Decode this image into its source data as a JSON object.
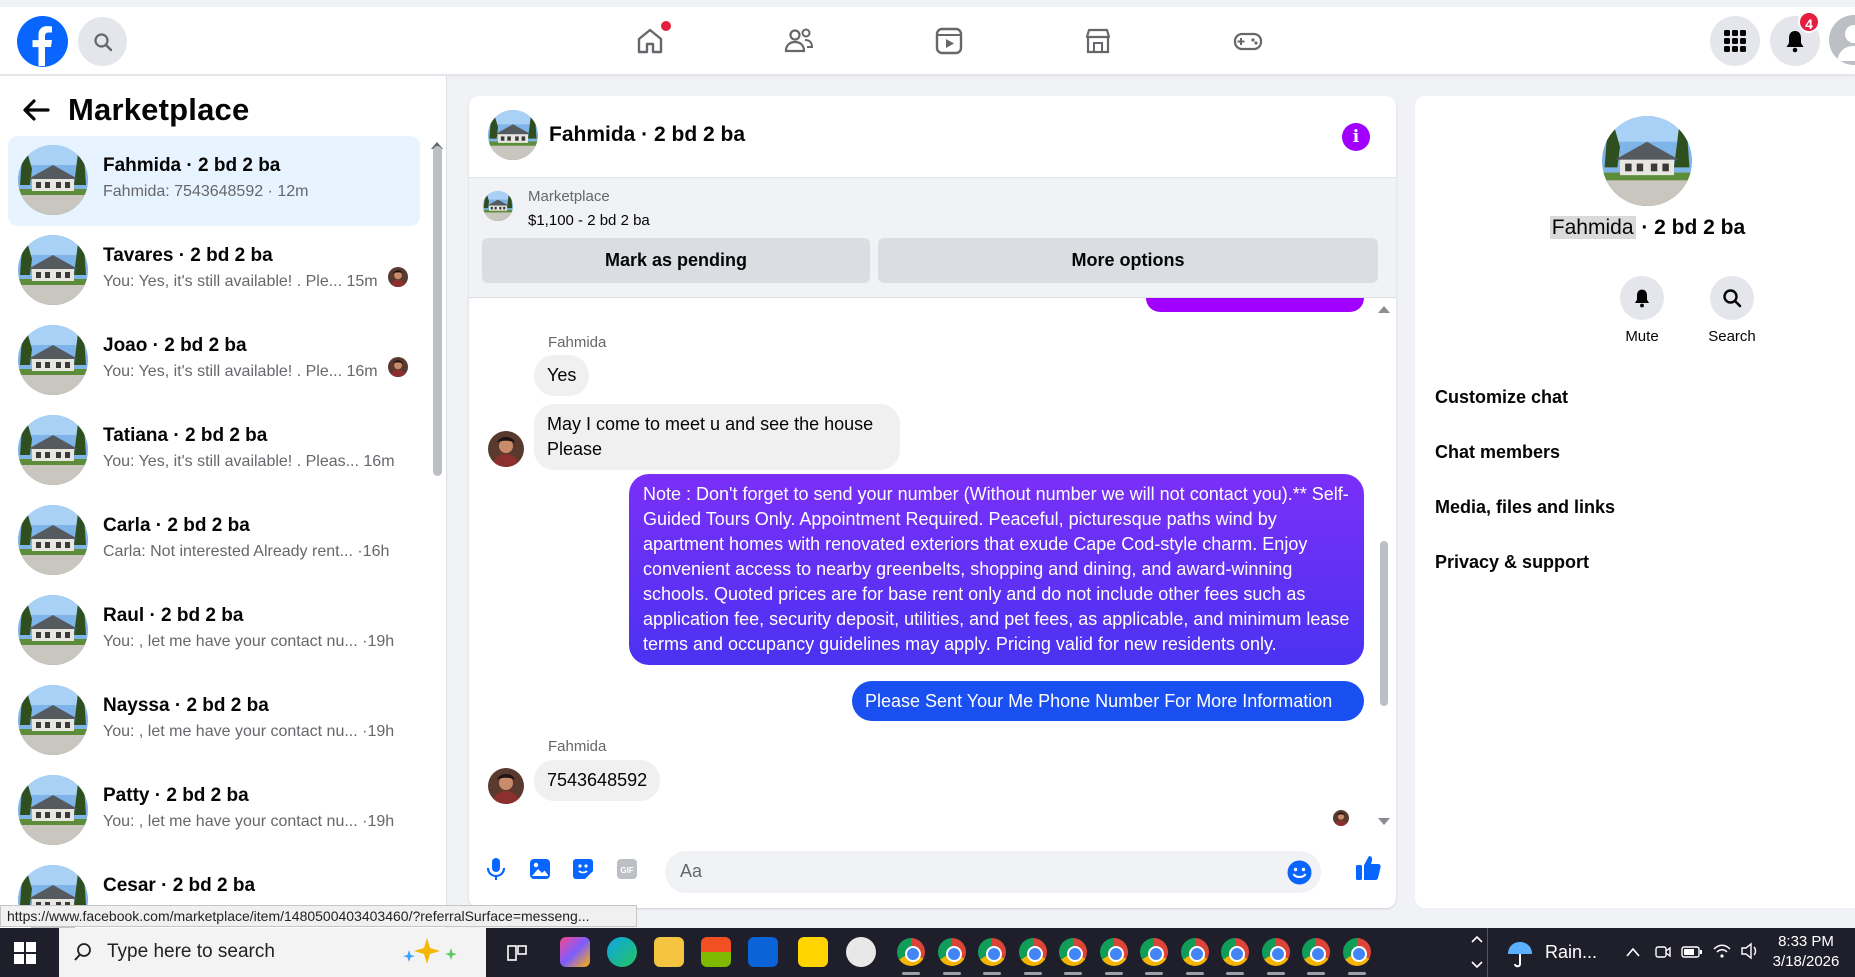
{
  "header": {
    "notification_count": "4",
    "brand_color": "#0866ff",
    "nav_icons": [
      "home-icon",
      "friends-icon",
      "video-icon",
      "marketplace-icon",
      "gaming-icon"
    ]
  },
  "sidebar": {
    "title": "Marketplace",
    "conversations": [
      {
        "name": "Fahmida · 2 bd 2 ba",
        "snippet": "Fahmida: 7543648592 · 12m",
        "active": true
      },
      {
        "name": "Tavares · 2 bd 2 ba",
        "snippet": "You: Yes, it's still available! . Ple...  15m"
      },
      {
        "name": "Joao · 2 bd 2 ba",
        "snippet": "You: Yes, it's still available! . Ple...  16m"
      },
      {
        "name": "Tatiana · 2 bd 2 ba",
        "snippet": "You: Yes, it's still available! . Pleas...    16m"
      },
      {
        "name": "Carla · 2 bd 2 ba",
        "snippet": "Carla: Not interested Already rent... ·16h"
      },
      {
        "name": "Raul · 2 bd 2 ba",
        "snippet": "You: , let me have your contact nu... ·19h"
      },
      {
        "name": "Nayssa · 2 bd 2 ba",
        "snippet": "You: , let me have your contact nu... ·19h"
      },
      {
        "name": "Patty · 2 bd 2 ba",
        "snippet": "You: , let me have your contact nu... ·19h"
      },
      {
        "name": "Cesar · 2 bd 2 ba",
        "snippet": ""
      }
    ]
  },
  "chat": {
    "title": "Fahmida · 2 bd 2 ba",
    "marketplace_label": "Marketplace",
    "listing": "$1,100 - 2 bd 2 ba",
    "mark_pending": "Mark as pending",
    "more_options": "More options",
    "sender_1": "Fahmida",
    "msg_yes": "Yes",
    "msg_meet": "May I come to meet u and see the house Please",
    "msg_note": "Note : Don't forget to send your number (Without number we will not contact you).** Self-Guided Tours Only. Appointment Required. Peaceful, picturesque paths wind by apartment homes with renovated exteriors that exude Cape Cod-style charm. Enjoy convenient access to nearby greenbelts, shopping and dining, and award-winning schools. Quoted prices are for base rent only and do not include other fees such as application fee, security deposit, utilities, and pet fees, as applicable, and minimum lease terms and occupancy guidelines may apply. Pricing valid for new residents only.",
    "msg_phone_request": "Please Sent Your Me Phone Number For More Information",
    "sender_2": "Fahmida",
    "msg_number": "7543648592",
    "composer_placeholder": "Aa"
  },
  "details": {
    "name_first": "Fahmida",
    "name_rest": " · 2 bd 2 ba",
    "mute": "Mute",
    "search": "Search",
    "sections": [
      "Customize chat",
      "Chat members",
      "Media, files and links",
      "Privacy & support"
    ]
  },
  "status_url": "https://www.facebook.com/marketplace/item/1480500403403460/?referralSurface=messeng...",
  "taskbar": {
    "search_placeholder": "Type here to search",
    "weather": "Rain...",
    "time": "8:33 PM",
    "date": "3/18/2026"
  }
}
